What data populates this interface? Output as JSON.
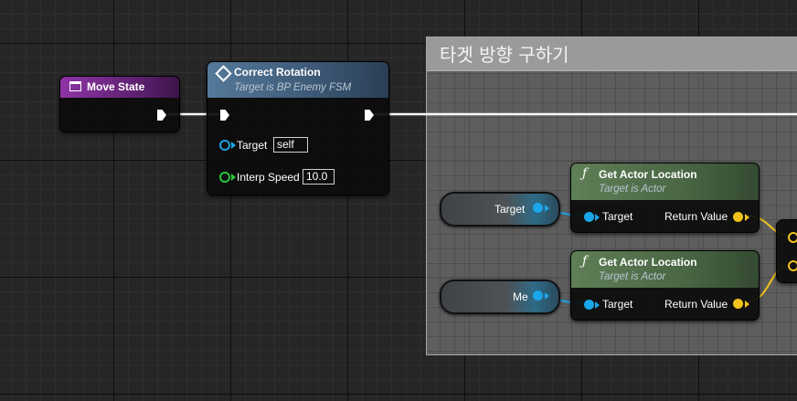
{
  "comment": {
    "title": "타겟 방향 구하기"
  },
  "move_state": {
    "title": "Move State",
    "color": "#7b2b8f"
  },
  "correct_rotation": {
    "title": "Correct Rotation",
    "subtitle": "Target is BP Enemy FSM",
    "target_label": "Target",
    "target_value": "self",
    "interp_label": "Interp Speed",
    "interp_value": "10.0"
  },
  "var_target": {
    "label": "Target"
  },
  "var_me": {
    "label": "Me"
  },
  "get_loc_1": {
    "title": "Get Actor Location",
    "subtitle": "Target is Actor",
    "in_label": "Target",
    "out_label": "Return Value"
  },
  "get_loc_2": {
    "title": "Get Actor Location",
    "subtitle": "Target is Actor",
    "in_label": "Target",
    "out_label": "Return Value"
  },
  "colors": {
    "exec": "#ffffff",
    "object_pin": "#1aa6ea",
    "vector_pin": "#f2c21a",
    "float_pin": "#29c43a",
    "function_header": "#4f6b4a"
  }
}
